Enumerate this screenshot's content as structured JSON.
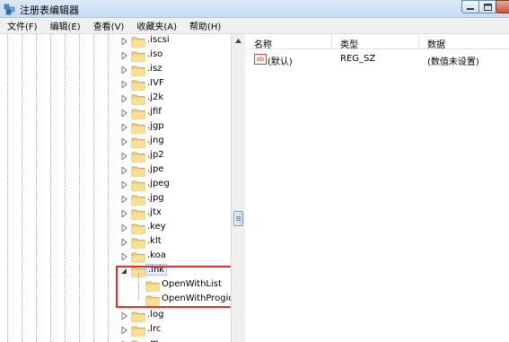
{
  "window": {
    "title": "注册表编辑器"
  },
  "menu": [
    "文件(F)",
    "编辑(E)",
    "查看(V)",
    "收藏夹(A)",
    "帮助(H)"
  ],
  "tree": {
    "nodes": [
      ".iscsi",
      ".iso",
      ".isz",
      ".IVF",
      ".j2k",
      ".jfif",
      ".jgp",
      ".jng",
      ".jp2",
      ".jpe",
      ".jpeg",
      ".jpg",
      ".jtx",
      ".key",
      ".klt",
      ".koa"
    ],
    "selected": {
      "label": ".lnk",
      "children": [
        "OpenWithList",
        "OpenWithProgids"
      ]
    },
    "after": [
      ".log",
      ".lrc",
      ".m"
    ]
  },
  "list": {
    "headers": {
      "name": "名称",
      "type": "类型",
      "data": "数据"
    },
    "rows": [
      {
        "name": "(默认)",
        "type": "REG_SZ",
        "data": "(数值未设置)"
      }
    ]
  }
}
